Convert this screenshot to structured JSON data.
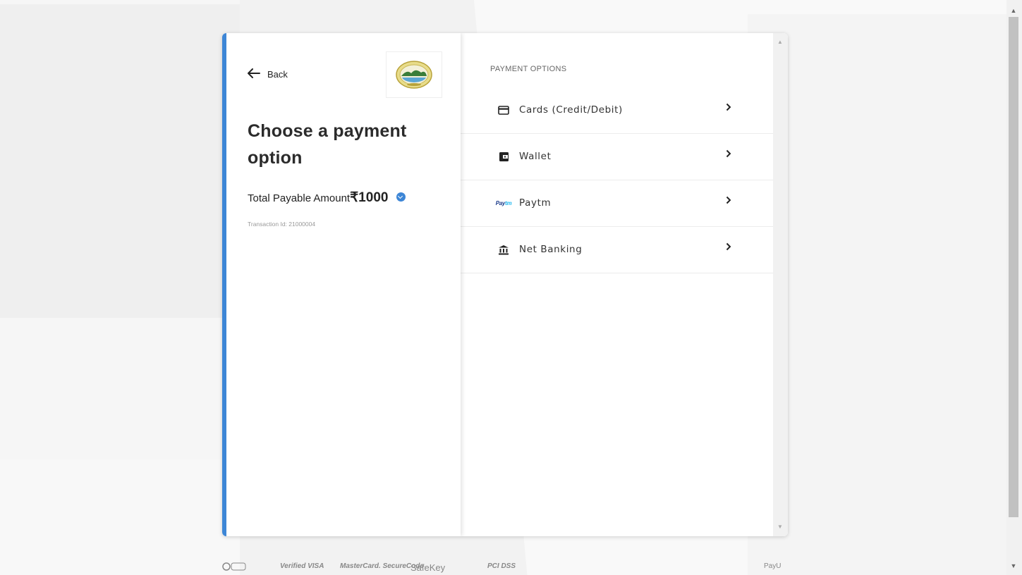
{
  "header": {
    "back_label": "Back",
    "logo_icon": "emblem-seal-icon"
  },
  "main": {
    "title": "Choose a payment option",
    "amount_label": "Total Payable Amount",
    "amount_value": "₹1000",
    "transaction_id": "Transaction Id: 21000004"
  },
  "payment": {
    "heading": "PAYMENT OPTIONS",
    "options": [
      {
        "label": "Cards (Credit/Debit)",
        "icon": "credit-card-icon"
      },
      {
        "label": "Wallet",
        "icon": "wallet-icon"
      },
      {
        "label": "Paytm",
        "icon": "paytm-logo-icon"
      },
      {
        "label": "Net Banking",
        "icon": "bank-icon"
      }
    ]
  },
  "footer": {
    "badges": [
      "Verified VISA",
      "MasterCard. SecureCode",
      "SafeKey",
      "PCI DSS",
      "PayU"
    ]
  },
  "colors": {
    "accent": "#3d86d6",
    "background": "#f2f2f2"
  }
}
